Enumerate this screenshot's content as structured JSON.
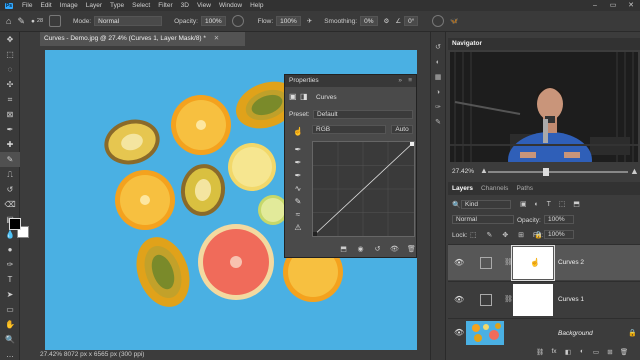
{
  "menu": {
    "items": [
      "File",
      "Edit",
      "Image",
      "Layer",
      "Type",
      "Select",
      "Filter",
      "3D",
      "View",
      "Window",
      "Help"
    ]
  },
  "options_bar": {
    "mode_label": "Mode:",
    "mode_value": "Normal",
    "opacity_label": "Opacity:",
    "opacity_value": "100%",
    "flow_label": "Flow:",
    "flow_value": "100%",
    "smoothing_label": "Smoothing:",
    "smoothing_value": "0%",
    "angle_value": "0°",
    "brush_size": "28"
  },
  "document": {
    "tab_title": "Curves - Demo.jpg @ 27.4% (Curves 1, Layer Mask/8) *",
    "status": "27.42%   8072 px x 6565 px (300 ppi)"
  },
  "properties": {
    "title": "Properties",
    "panel_type": "Curves",
    "preset_label": "Preset:",
    "preset_value": "Default",
    "channel_value": "RGB",
    "auto_label": "Auto"
  },
  "navigator": {
    "title": "Navigator",
    "zoom": "27.42%"
  },
  "layers": {
    "tabs": [
      "Layers",
      "Channels",
      "Paths"
    ],
    "filter_value": "Kind",
    "blend_value": "Normal",
    "opacity_label": "Opacity:",
    "opacity_value": "100%",
    "lock_label": "Lock:",
    "fill_label": "Fill:",
    "fill_value": "100%",
    "items": [
      {
        "name": "Curves 2"
      },
      {
        "name": "Curves 1"
      },
      {
        "name": "Background"
      }
    ]
  },
  "colors": {
    "canvas_blue": "#4ab0e3",
    "selected_layer": "#575757",
    "ps_blue": "#31a8ff"
  }
}
